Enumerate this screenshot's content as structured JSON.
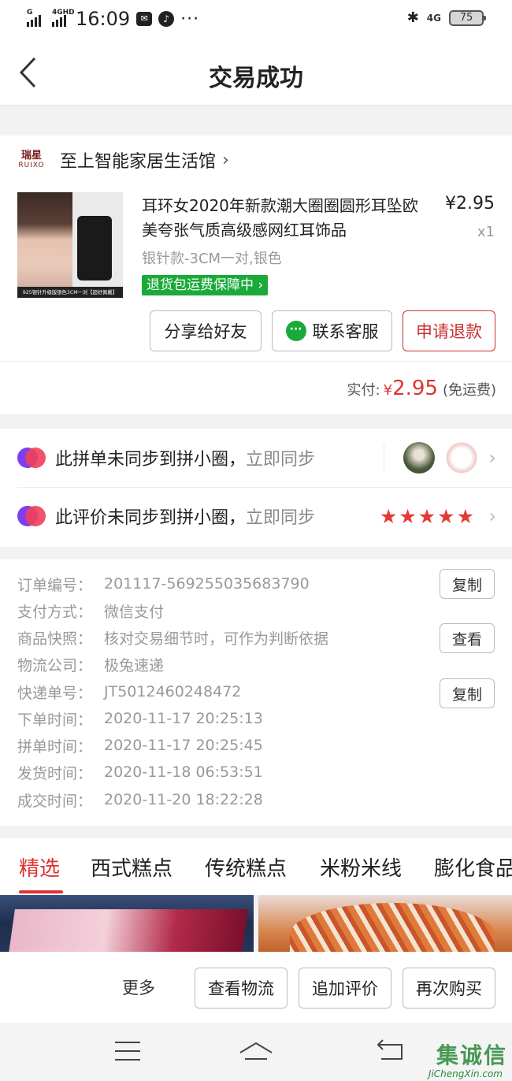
{
  "status_bar": {
    "signal1_label": "G",
    "signal2_label": "4GHD",
    "time": "16:09",
    "more": "···",
    "network": "4G",
    "battery": "75"
  },
  "nav": {
    "title": "交易成功"
  },
  "shop": {
    "logo_text": "瑞星",
    "logo_sub": "RUIXO",
    "name": "至上智能家居生活馆"
  },
  "product": {
    "title": "耳环女2020年新款潮大圈圈圆形耳坠欧美夸张气质高级感网红耳饰品",
    "price": "¥2.95",
    "qty": "x1",
    "spec": "银针款-3CM一对,银色",
    "badge": "退货包运费保障中",
    "image_caption": "925银针升级版银色3CM一对【超好佩戴】"
  },
  "actions": {
    "share": "分享给好友",
    "service": "联系客服",
    "refund": "申请退款"
  },
  "payment": {
    "label": "实付:",
    "currency": "¥",
    "amount": "2.95",
    "note": "(免运费)"
  },
  "sync": {
    "order_text": "此拼单未同步到拼小圈，",
    "order_link": "立即同步",
    "review_text": "此评价未同步到拼小圈，",
    "review_link": "立即同步",
    "stars": "★★★★★",
    "rating": 5
  },
  "order_info": [
    {
      "label": "订单编号：",
      "value": "201117-569255035683790",
      "button": "复制"
    },
    {
      "label": "支付方式：",
      "value": "微信支付"
    },
    {
      "label": "商品快照：",
      "value": "核对交易细节时，可作为判断依据",
      "button": "查看"
    },
    {
      "label": "物流公司：",
      "value": "极兔速递"
    },
    {
      "label": "快递单号：",
      "value": "JT5012460248472",
      "button": "复制"
    },
    {
      "label": "下单时间：",
      "value": "2020-11-17 20:25:13"
    },
    {
      "label": "拼单时间：",
      "value": "2020-11-17 20:25:45"
    },
    {
      "label": "发货时间：",
      "value": "2020-11-18 06:53:51"
    },
    {
      "label": "成交时间：",
      "value": "2020-11-20 18:22:28"
    }
  ],
  "tabs": [
    "精选",
    "西式糕点",
    "传统糕点",
    "米粉米线",
    "膨化食品"
  ],
  "bottom_bar": {
    "more": "更多",
    "logistics": "查看物流",
    "add_review": "追加评价",
    "rebuy": "再次购买"
  },
  "watermark": {
    "text": "集诚信",
    "url": "JiChengXin.com"
  },
  "colors": {
    "accent": "#d33333",
    "green": "#1aaa3a",
    "muted": "#999999"
  }
}
